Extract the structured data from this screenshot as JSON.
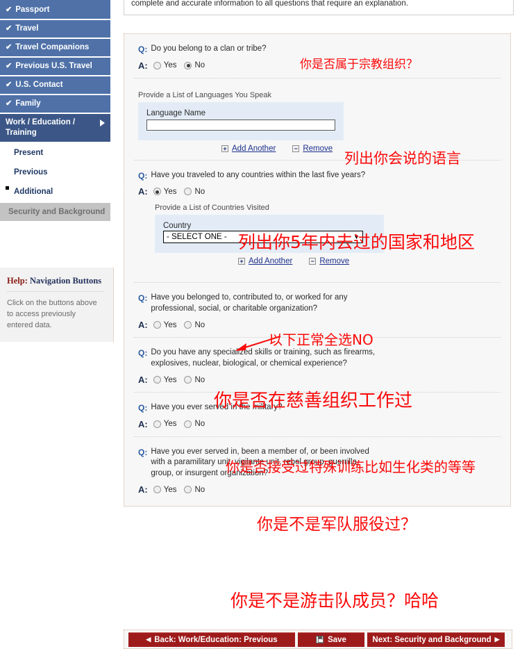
{
  "sidebar": {
    "completed_items": [
      {
        "label": "Passport",
        "icon": "check-icon"
      },
      {
        "label": "Travel",
        "icon": "check-icon"
      },
      {
        "label": "Travel Companions",
        "icon": "check-icon"
      },
      {
        "label": "Previous U.S. Travel",
        "icon": "check-icon"
      },
      {
        "label": "U.S. Contact",
        "icon": "check-icon"
      },
      {
        "label": "Family",
        "icon": "check-icon"
      }
    ],
    "active_item": {
      "label": "Work / Education / Training",
      "icon": "triangle-right-icon"
    },
    "sub_items": [
      {
        "label": "Present",
        "bullet": false
      },
      {
        "label": "Previous",
        "bullet": false
      },
      {
        "label": "Additional",
        "bullet": true
      }
    ],
    "disabled_item": {
      "label": "Security and Background"
    },
    "help": {
      "title_prefix": "Help:",
      "title_rest": " Navigation Buttons",
      "body": "Click on the buttons above to access previously entered data."
    }
  },
  "main": {
    "intro_text": "complete and accurate information to all questions that require an explanation.",
    "questions": [
      {
        "q_label": "Q:",
        "a_label": "A:",
        "text": "Do you belong to a clan or tribe?",
        "yes_label": "Yes",
        "no_label": "No",
        "selected": "No"
      },
      {
        "q_label": "Q:",
        "a_label": "A:",
        "text": "Have you traveled to any countries within the last five years?",
        "yes_label": "Yes",
        "no_label": "No",
        "selected": "Yes"
      },
      {
        "q_label": "Q:",
        "a_label": "A:",
        "text": "Have you belonged to, contributed to, or worked for any professional, social, or charitable organization?",
        "yes_label": "Yes",
        "no_label": "No",
        "selected": ""
      },
      {
        "q_label": "Q:",
        "a_label": "A:",
        "text": "Do you have any specialized skills or training, such as firearms, explosives, nuclear, biological, or chemical experience?",
        "yes_label": "Yes",
        "no_label": "No",
        "selected": ""
      },
      {
        "q_label": "Q:",
        "a_label": "A:",
        "text": "Have you ever served in the military?",
        "yes_label": "Yes",
        "no_label": "No",
        "selected": ""
      },
      {
        "q_label": "Q:",
        "a_label": "A:",
        "text": "Have you ever served in, been a member of, or been involved with a paramilitary unit, vigilante unit, rebel group, guerrilla group, or insurgent organization?",
        "yes_label": "Yes",
        "no_label": "No",
        "selected": ""
      }
    ],
    "languages": {
      "section_title": "Provide a List of Languages You Speak",
      "field_label": "Language Name",
      "field_value": "",
      "add_label": "Add Another",
      "remove_label": "Remove",
      "add_icon": "plus-icon",
      "remove_icon": "minus-icon"
    },
    "countries": {
      "section_title": "Provide a List of Countries Visited",
      "field_label": "Country",
      "selected_option": "- SELECT ONE -",
      "add_label": "Add Another",
      "remove_label": "Remove",
      "add_icon": "plus-icon",
      "remove_icon": "minus-icon"
    }
  },
  "annotations": {
    "color": "#fb0a0a",
    "items": [
      {
        "text": "你是否属于宗教组织？",
        "size": 17
      },
      {
        "text": "列出你会说的语言",
        "size": 20
      },
      {
        "text": "列出你5年内去过的国家和地区",
        "size": 24
      },
      {
        "text": "以下正常全选NO",
        "size": 19
      },
      {
        "text": "你是否在慈善组织工作过",
        "size": 25
      },
      {
        "text": "你是否接受过特殊训练比如生化类的等等",
        "size": 19
      },
      {
        "text": "你是不是军队服役过？",
        "size": 22
      },
      {
        "text": "你是不是游击队成员？哈哈",
        "size": 24
      }
    ]
  },
  "footer": {
    "back_label": "Back: Work/Education: Previous",
    "save_label": "Save",
    "next_label": "Next: Security and Background",
    "back_icon": "triangle-left-icon",
    "save_icon": "floppy-disk-icon",
    "next_icon": "triangle-right-icon"
  }
}
